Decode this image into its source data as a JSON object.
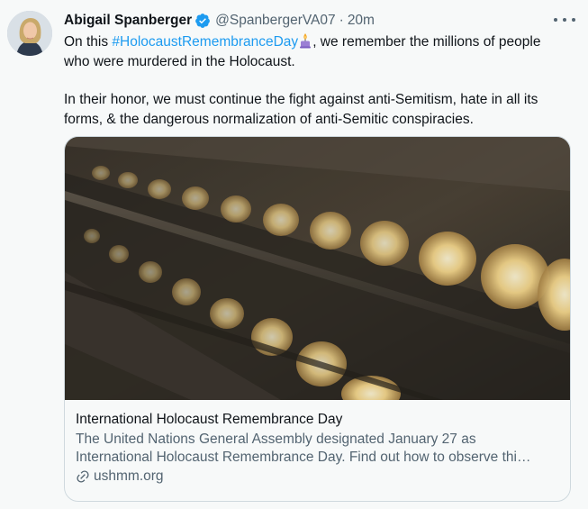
{
  "tweet": {
    "author_name": "Abigail Spanberger",
    "author_handle": "@SpanbergerVA07",
    "separator": "·",
    "timestamp": "20m",
    "text_part1": "On this ",
    "hashtag": "#HolocaustRemembranceDay",
    "text_part2": ", we remember the millions of people who were murdered in the Holocaust.",
    "paragraph2": "In their honor, we must continue the fight against anti-Semitism, hate in all its forms, & the dangerous normalization of anti-Semitic conspiracies."
  },
  "card": {
    "title": "International Holocaust Remembrance Day",
    "description_line1": "The United Nations General Assembly designated January 27 as",
    "description_line2": "International Holocaust Remembrance Day. Find out how to observe thi…",
    "domain": "ushmm.org"
  },
  "colors": {
    "link_blue": "#1d9bf0",
    "secondary_text": "#536471",
    "background": "#f7f9f9"
  },
  "icons": [
    "verified-badge-icon",
    "more-options-icon",
    "candle-emoji-icon",
    "link-icon"
  ]
}
